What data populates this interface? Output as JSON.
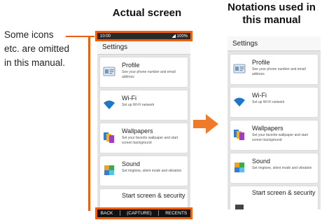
{
  "titles": {
    "actual": "Actual screen",
    "manual_line1": "Notations used in",
    "manual_line2": "this manual"
  },
  "note": {
    "line1": "Some icons",
    "line2": "etc. are omitted",
    "line3": "in this manual."
  },
  "statusbar": {
    "time": "10:00",
    "battery": "100%"
  },
  "appbar": {
    "title": "Settings"
  },
  "items": [
    {
      "label": "Profile",
      "sub": "See your phone number and email address",
      "icon": "profile-card-icon"
    },
    {
      "label": "Wi-Fi",
      "sub": "Set up Wi-Fi network",
      "icon": "wifi-icon"
    },
    {
      "label": "Wallpapers",
      "sub": "Set your favorite wallpaper and start screen background",
      "icon": "wallpaper-icon"
    },
    {
      "label": "Sound",
      "sub": "Set ringtone, silent mode and vibration",
      "icon": "sound-icon"
    },
    {
      "label": "Start screen & security",
      "sub": "",
      "icon": "screen-lock-icon"
    }
  ],
  "navbar": {
    "back": "BACK",
    "capture": "(CAPTURE)",
    "recents": "RECENTS"
  },
  "colors": {
    "accent": "#ef5f12",
    "wifi": "#1e78c8"
  }
}
